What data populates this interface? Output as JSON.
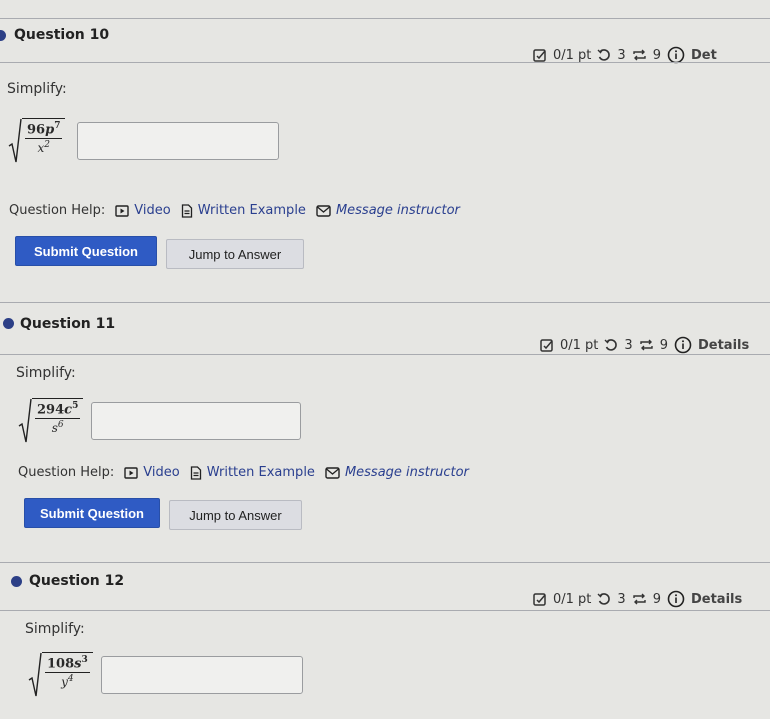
{
  "questions": [
    {
      "title": "Question 10",
      "score": "0/1 pt",
      "retries": "3",
      "attempts": "9",
      "details_label": "Det",
      "prompt": "Simplify:",
      "expression": {
        "num_coef": "96",
        "num_var": "p",
        "num_exp": "7",
        "den_var": "x",
        "den_exp": "2"
      },
      "answer_value": "",
      "help_label": "Question Help:",
      "help_links": {
        "video": "Video",
        "written_example": "Written Example",
        "message": "Message instructor"
      },
      "submit_label": "Submit Question",
      "jump_label": "Jump to Answer"
    },
    {
      "title": "Question 11",
      "score": "0/1 pt",
      "retries": "3",
      "attempts": "9",
      "details_label": "Details",
      "prompt": "Simplify:",
      "expression": {
        "num_coef": "294",
        "num_var": "c",
        "num_exp": "5",
        "den_var": "s",
        "den_exp": "6"
      },
      "answer_value": "",
      "help_label": "Question Help:",
      "help_links": {
        "video": "Video",
        "written_example": "Written Example",
        "message": "Message instructor"
      },
      "submit_label": "Submit Question",
      "jump_label": "Jump to Answer"
    },
    {
      "title": "Question 12",
      "score": "0/1 pt",
      "retries": "3",
      "attempts": "9",
      "details_label": "Details",
      "prompt": "Simplify:",
      "expression": {
        "num_coef": "108",
        "num_var": "s",
        "num_exp": "3",
        "den_var": "y",
        "den_exp": "4"
      },
      "answer_value": ""
    }
  ],
  "icons": {
    "score": "checkbox-edit-icon",
    "retries": "retry-icon",
    "attempts": "attempts-cycle-icon",
    "details": "info-circle-icon",
    "video": "video-play-icon",
    "written_example": "document-icon",
    "message": "envelope-icon"
  },
  "colors": {
    "accent": "#2f5bc4",
    "link": "#2a3f8f",
    "bullet": "#2c3f86",
    "background": "#e6e6e3"
  }
}
